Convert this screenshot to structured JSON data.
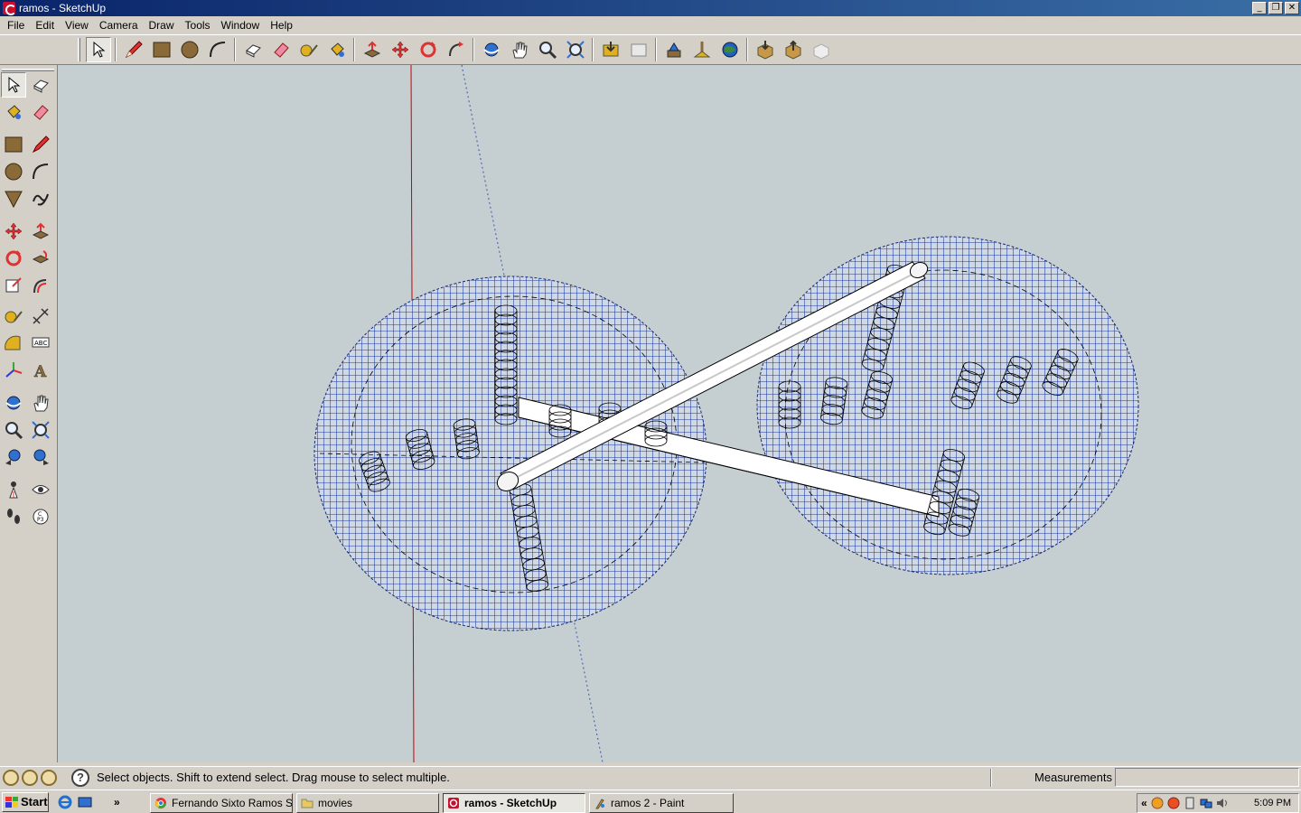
{
  "window": {
    "title": "ramos - SketchUp",
    "controls": [
      "minimize",
      "restore",
      "close"
    ]
  },
  "menu": [
    "File",
    "Edit",
    "View",
    "Camera",
    "Draw",
    "Tools",
    "Window",
    "Help"
  ],
  "toolbar": {
    "icons": [
      "select-icon",
      "pencil-icon",
      "rectangle-icon",
      "circle-icon",
      "arc-icon",
      "make-component-icon",
      "eraser-icon",
      "tape-measure-icon",
      "paint-bucket-icon",
      "push-pull-icon",
      "move-icon",
      "rotate-icon",
      "follow-me-icon",
      "orbit-icon",
      "pan-icon",
      "zoom-icon",
      "zoom-extents-icon",
      "get-models-icon",
      "share-model-icon",
      "preview-google-earth-icon",
      "add-location-icon",
      "toggle-terrain-icon",
      "get-current-view-icon",
      "place-model-icon",
      "get-models-3d-warehouse-icon",
      "share-component-icon"
    ]
  },
  "left_toolbar": {
    "icons": [
      "select-icon",
      "make-component-icon",
      "paint-bucket-icon",
      "eraser-icon",
      "rectangle-icon",
      "line-icon",
      "circle-icon",
      "arc-icon",
      "polygon-icon",
      "freehand-icon",
      "move-icon",
      "push-pull-icon",
      "rotate-icon",
      "follow-me-icon",
      "scale-icon",
      "offset-icon",
      "tape-measure-icon",
      "dimension-icon",
      "protractor-icon",
      "text-icon",
      "axes-icon",
      "3d-text-icon",
      "orbit-icon",
      "pan-icon",
      "zoom-icon",
      "zoom-window-icon",
      "previous-view-icon",
      "zoom-extents-icon",
      "position-camera-icon",
      "look-around-icon",
      "walk-icon",
      "section-plane-icon"
    ]
  },
  "status": {
    "message": "Select objects. Shift to extend select. Drag mouse to select multiple.",
    "measurements_label": "Measurements",
    "measurements_value": ""
  },
  "taskbar": {
    "start_label": "Start",
    "tasks": [
      {
        "label": "Fernando Sixto Ramos S...",
        "icon": "chrome-icon",
        "active": false
      },
      {
        "label": "movies",
        "icon": "folder-icon",
        "active": false
      },
      {
        "label": "ramos - SketchUp",
        "icon": "sketchup-icon",
        "active": true
      },
      {
        "label": "ramos 2 - Paint",
        "icon": "paint-icon",
        "active": false
      }
    ],
    "clock": "5:09 PM"
  },
  "colors": {
    "viewport_bg": "#c5ced1",
    "grid_blue": "#1a3a9a",
    "red_axis": "#cc0000",
    "titlebar": "#0a246a"
  }
}
